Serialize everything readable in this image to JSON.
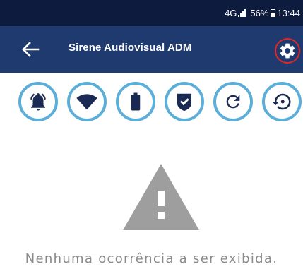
{
  "status_bar": {
    "network": "4G",
    "battery": "56%",
    "time": "13:44",
    "icons": [
      "signal-icon",
      "battery-icon"
    ]
  },
  "app_bar": {
    "title": "Sirene Audiovisual ADM",
    "back_icon": "arrow-left-icon",
    "settings_icon": "gear-icon",
    "settings_highlight_color": "#e02626",
    "background": "#1e3a6e"
  },
  "actions": [
    {
      "icon": "alarm-bell-icon"
    },
    {
      "icon": "wifi-icon"
    },
    {
      "icon": "battery-icon"
    },
    {
      "icon": "shield-check-icon"
    },
    {
      "icon": "refresh-icon"
    },
    {
      "icon": "history-icon"
    }
  ],
  "accent_color": "#5aaed8",
  "empty_state": {
    "icon": "warning-icon",
    "message": "Nenhuma ocorrência a ser exibida."
  }
}
